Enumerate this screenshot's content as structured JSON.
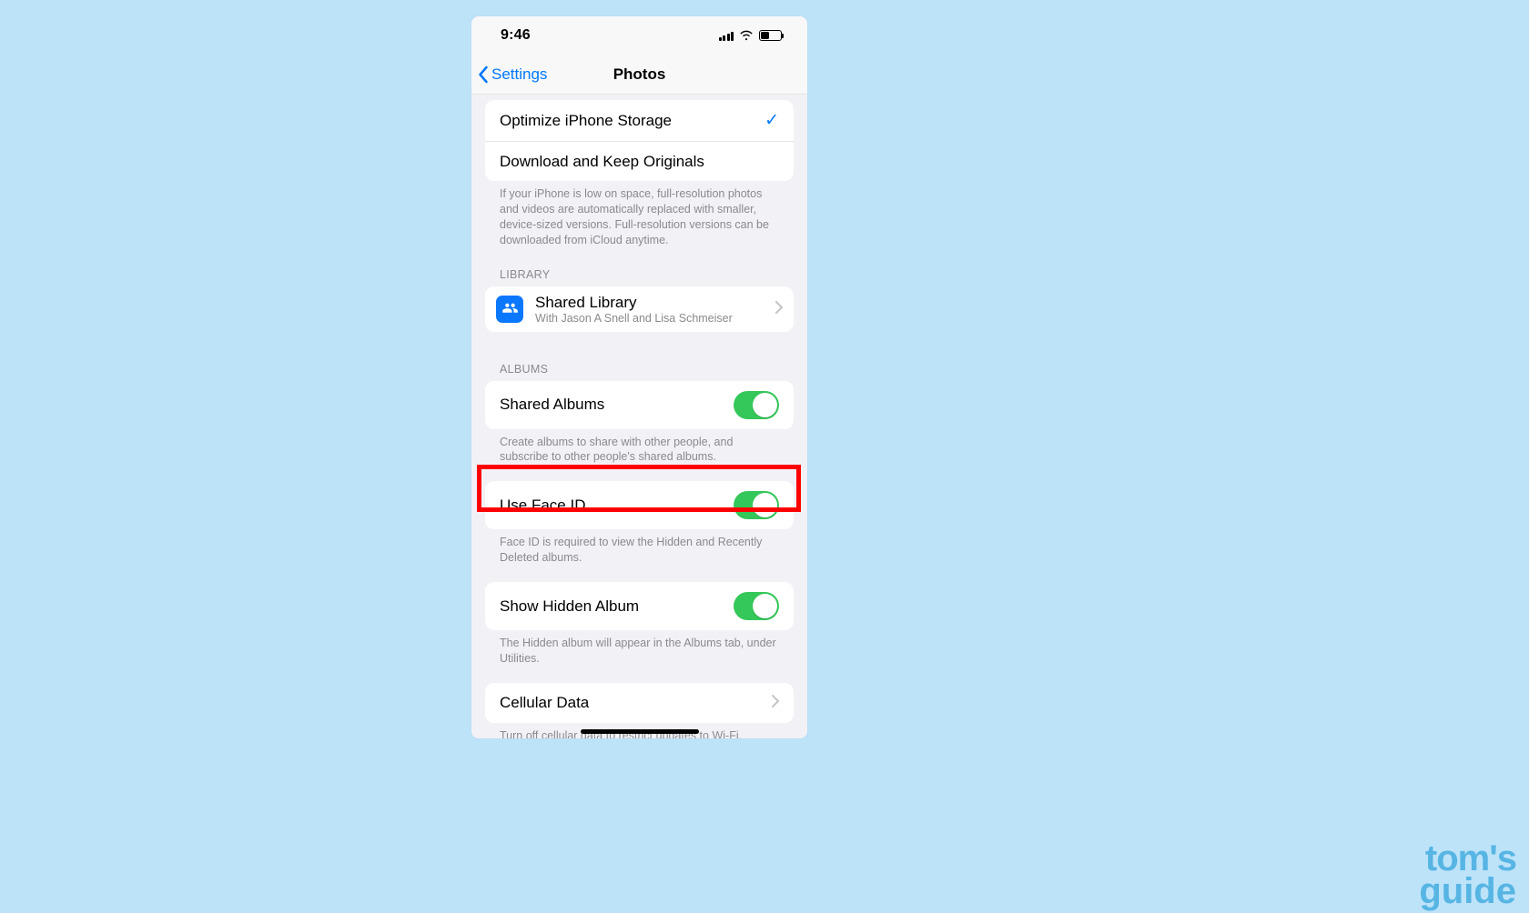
{
  "status": {
    "time": "9:46"
  },
  "nav": {
    "back": "Settings",
    "title": "Photos"
  },
  "storage": {
    "optimize": "Optimize iPhone Storage",
    "download": "Download and Keep Originals",
    "footer": "If your iPhone is low on space, full-resolution photos and videos are automatically replaced with smaller, device-sized versions. Full-resolution versions can be downloaded from iCloud anytime."
  },
  "library": {
    "header": "LIBRARY",
    "title": "Shared Library",
    "sub": "With Jason A Snell and Lisa Schmeiser"
  },
  "albums": {
    "header": "ALBUMS",
    "shared_label": "Shared Albums",
    "shared_footer": "Create albums to share with other people, and subscribe to other people's shared albums.",
    "faceid_label": "Use Face ID",
    "faceid_footer": "Face ID is required to view the Hidden and Recently Deleted albums.",
    "hidden_label": "Show Hidden Album",
    "hidden_footer": "The Hidden album will appear in the Albums tab, under Utilities."
  },
  "cellular": {
    "label": "Cellular Data",
    "footer": "Turn off cellular data to restrict updates to Wi-Fi, including Shared Albums and iCloud Photos."
  },
  "watermark": {
    "l1": "tom's",
    "l2": "guide"
  }
}
